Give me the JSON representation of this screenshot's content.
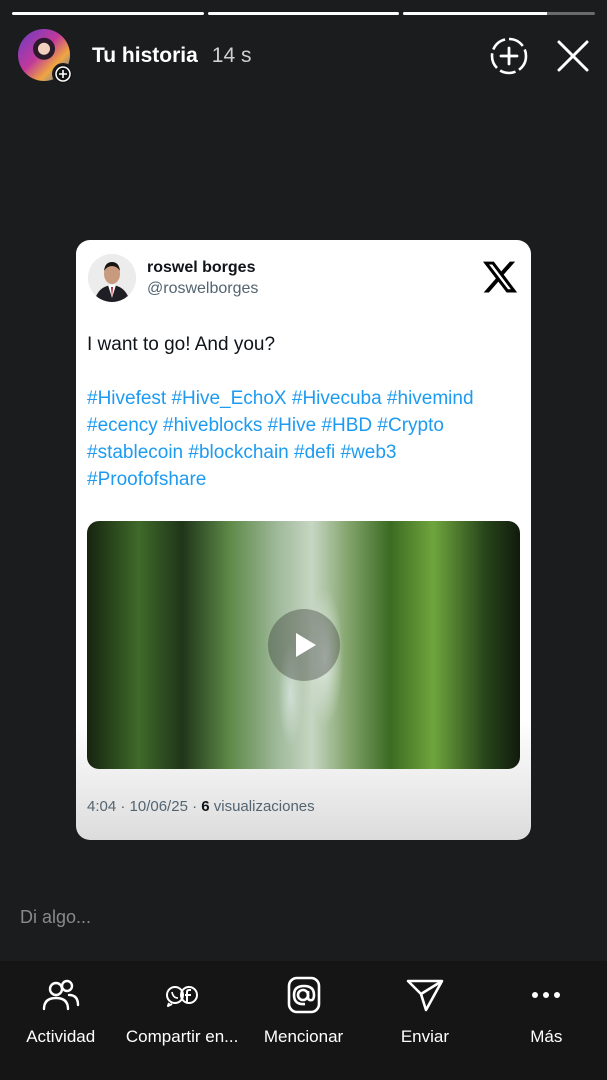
{
  "progress": [
    1,
    1,
    0.75
  ],
  "header": {
    "title": "Tu historia",
    "time": "14 s"
  },
  "tweet": {
    "name": "roswel borges",
    "handle": "@roswelborges",
    "text": "I want to go! And you?",
    "hashtags": "#Hivefest #Hive_EchoX #Hivecuba #hivemind #ecency #hiveblocks #Hive #HBD #Crypto #stablecoin #blockchain #defi #web3 #Proofofshare",
    "meta_prefix": "4:04 · 10/06/25 · ",
    "views_count": "6",
    "views_label": " visualizaciones",
    "link_color": "#1d9bf0"
  },
  "reply_placeholder": "Di algo...",
  "bottom_bar": [
    {
      "label": "Actividad",
      "icon": "people-icon"
    },
    {
      "label": "Compartir en...",
      "icon": "whatsapp-facebook-icon"
    },
    {
      "label": "Mencionar",
      "icon": "at-sign-icon"
    },
    {
      "label": "Enviar",
      "icon": "paper-plane-icon"
    },
    {
      "label": "Más",
      "icon": "more-dots-icon"
    }
  ]
}
